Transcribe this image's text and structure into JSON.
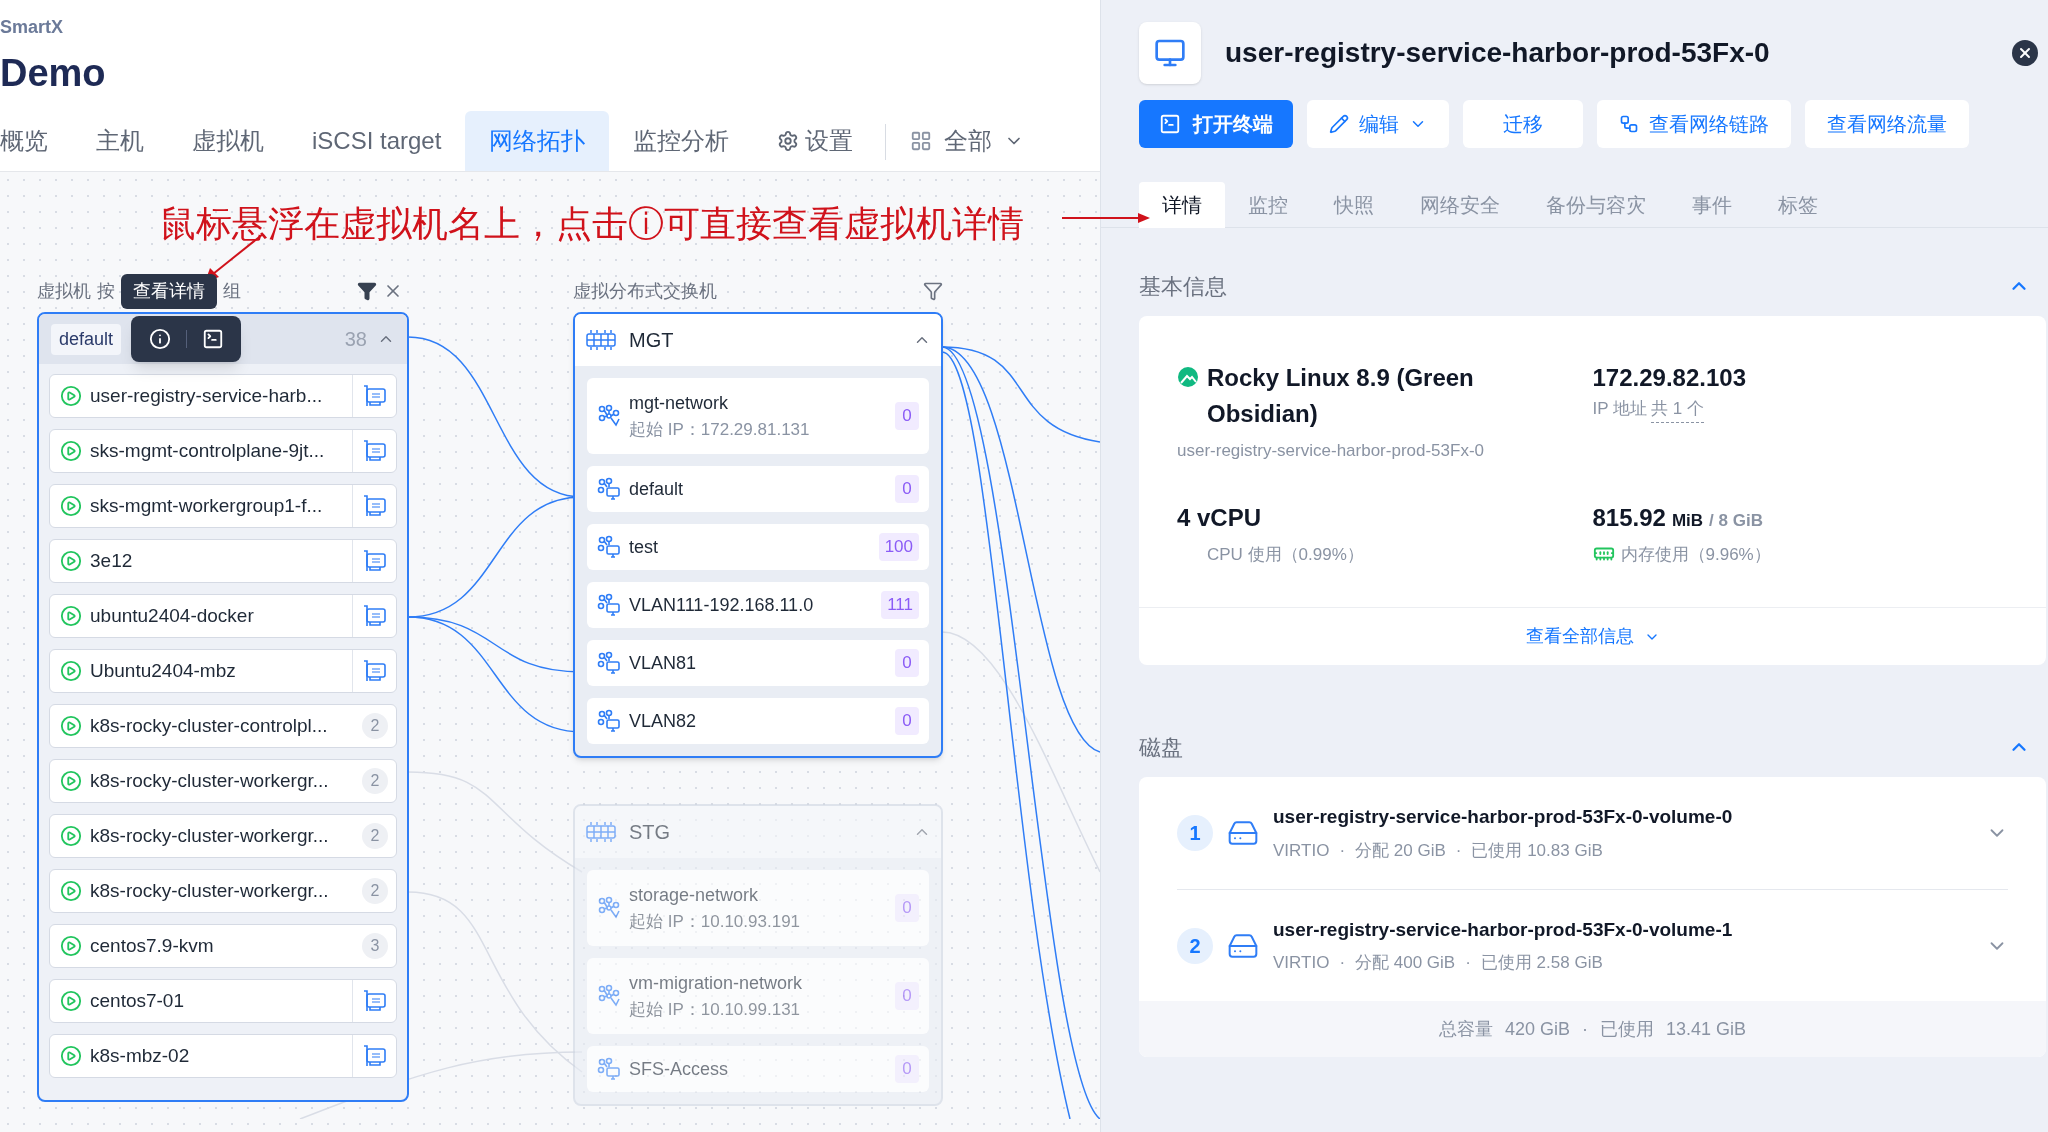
{
  "app": {
    "brand": "SmartX",
    "title": "Demo"
  },
  "nav_tabs": [
    {
      "label": "概览",
      "selected": false,
      "kind": "plain"
    },
    {
      "label": "主机",
      "selected": false,
      "kind": "plain"
    },
    {
      "label": "虚拟机",
      "selected": false,
      "kind": "plain"
    },
    {
      "label": "iSCSI target",
      "selected": false,
      "kind": "plain"
    },
    {
      "label": "网络拓扑",
      "selected": true,
      "kind": "plain"
    },
    {
      "label": "监控分析",
      "selected": false,
      "kind": "plain"
    },
    {
      "label": "设置",
      "selected": false,
      "kind": "settings"
    }
  ],
  "scope": {
    "label": "全部"
  },
  "annotation": {
    "text": "鼠标悬浮在虚拟机名上，点击ⓘ可直接查看虚拟机详情"
  },
  "vm_column": {
    "label_parts": [
      "虚拟机",
      "按",
      "组"
    ],
    "tooltip": "查看详情",
    "group": {
      "name": "default",
      "count": "38",
      "expanded": true
    },
    "vms": [
      {
        "name": "user-registry-service-harb...",
        "kind": "nic"
      },
      {
        "name": "sks-mgmt-controlplane-9jt...",
        "kind": "nic"
      },
      {
        "name": "sks-mgmt-workergroup1-f...",
        "kind": "nic"
      },
      {
        "name": "3e12",
        "kind": "nic"
      },
      {
        "name": "ubuntu2404-docker",
        "kind": "nic"
      },
      {
        "name": "Ubuntu2404-mbz",
        "kind": "nic"
      },
      {
        "name": "k8s-rocky-cluster-controlpl...",
        "kind": "count",
        "count": "2"
      },
      {
        "name": "k8s-rocky-cluster-workergr...",
        "kind": "count",
        "count": "2"
      },
      {
        "name": "k8s-rocky-cluster-workergr...",
        "kind": "count",
        "count": "2"
      },
      {
        "name": "k8s-rocky-cluster-workergr...",
        "kind": "count",
        "count": "2"
      },
      {
        "name": "centos7.9-kvm",
        "kind": "count",
        "count": "3"
      },
      {
        "name": "centos7-01",
        "kind": "nic"
      },
      {
        "name": "k8s-mbz-02",
        "kind": "nic"
      }
    ]
  },
  "switch_column": {
    "label": "虚拟分布式交换机",
    "switches": [
      {
        "name": "MGT",
        "expanded": true,
        "dimmed": false,
        "networks": [
          {
            "name": "mgt-network",
            "start_ip": "起始 IP：172.29.81.131",
            "vlan": "0",
            "kind": "system"
          },
          {
            "name": "default",
            "vlan": "0",
            "kind": "vm"
          },
          {
            "name": "test",
            "vlan": "100",
            "kind": "vm"
          },
          {
            "name": "VLAN111-192.168.11.0",
            "vlan": "111",
            "kind": "vm"
          },
          {
            "name": "VLAN81",
            "vlan": "0",
            "kind": "vm"
          },
          {
            "name": "VLAN82",
            "vlan": "0",
            "kind": "vm"
          }
        ]
      },
      {
        "name": "STG",
        "expanded": true,
        "dimmed": true,
        "networks": [
          {
            "name": "storage-network",
            "start_ip": "起始 IP：10.10.93.191",
            "vlan": "0",
            "kind": "system"
          },
          {
            "name": "vm-migration-network",
            "start_ip": "起始 IP：10.10.99.131",
            "vlan": "0",
            "kind": "system"
          },
          {
            "name": "SFS-Access",
            "vlan": "0",
            "kind": "vm"
          }
        ]
      }
    ]
  },
  "detail": {
    "title": "user-registry-service-harbor-prod-53Fx-0",
    "actions": [
      {
        "label": "打开终端",
        "kind": "primary"
      },
      {
        "label": "编辑",
        "kind": "dropdown"
      },
      {
        "label": "迁移",
        "kind": "plain"
      },
      {
        "label": "查看网络链路",
        "kind": "link"
      },
      {
        "label": "查看网络流量",
        "kind": "plain"
      }
    ],
    "tabs": [
      {
        "label": "详情",
        "selected": true
      },
      {
        "label": "监控",
        "selected": false
      },
      {
        "label": "快照",
        "selected": false
      },
      {
        "label": "网络安全",
        "selected": false
      },
      {
        "label": "备份与容灾",
        "selected": false
      },
      {
        "label": "事件",
        "selected": false
      },
      {
        "label": "标签",
        "selected": false
      }
    ],
    "basic_info": {
      "title": "基本信息",
      "expanded": true,
      "os": "Rocky Linux 8.9 (Green Obsidian)",
      "vm_name": "user-registry-service-harbor-prod-53Fx-0",
      "ip": "172.29.82.103",
      "ip_caption": "IP 地址",
      "ip_count": "共 1 个",
      "cpu": "4 vCPU",
      "cpu_usage": "CPU 使用（0.99%）",
      "memory_value": "815.92",
      "memory_unit": "MiB",
      "memory_total": "/ 8 GiB",
      "memory_usage": "内存使用（9.96%）",
      "more": "查看全部信息"
    },
    "disks": {
      "title": "磁盘",
      "expanded": true,
      "items": [
        {
          "index": "1",
          "name": "user-registry-service-harbor-prod-53Fx-0-volume-0",
          "meta": [
            "VIRTIO",
            "分配 20 GiB",
            "已使用 10.83 GiB"
          ]
        },
        {
          "index": "2",
          "name": "user-registry-service-harbor-prod-53Fx-0-volume-1",
          "meta": [
            "VIRTIO",
            "分配 400 GiB",
            "已使用 2.58 GiB"
          ]
        }
      ],
      "separator": "·",
      "footer": {
        "total_label": "总容量",
        "total": "420 GiB",
        "used_label": "已使用",
        "used": "13.41 GiB"
      }
    }
  }
}
